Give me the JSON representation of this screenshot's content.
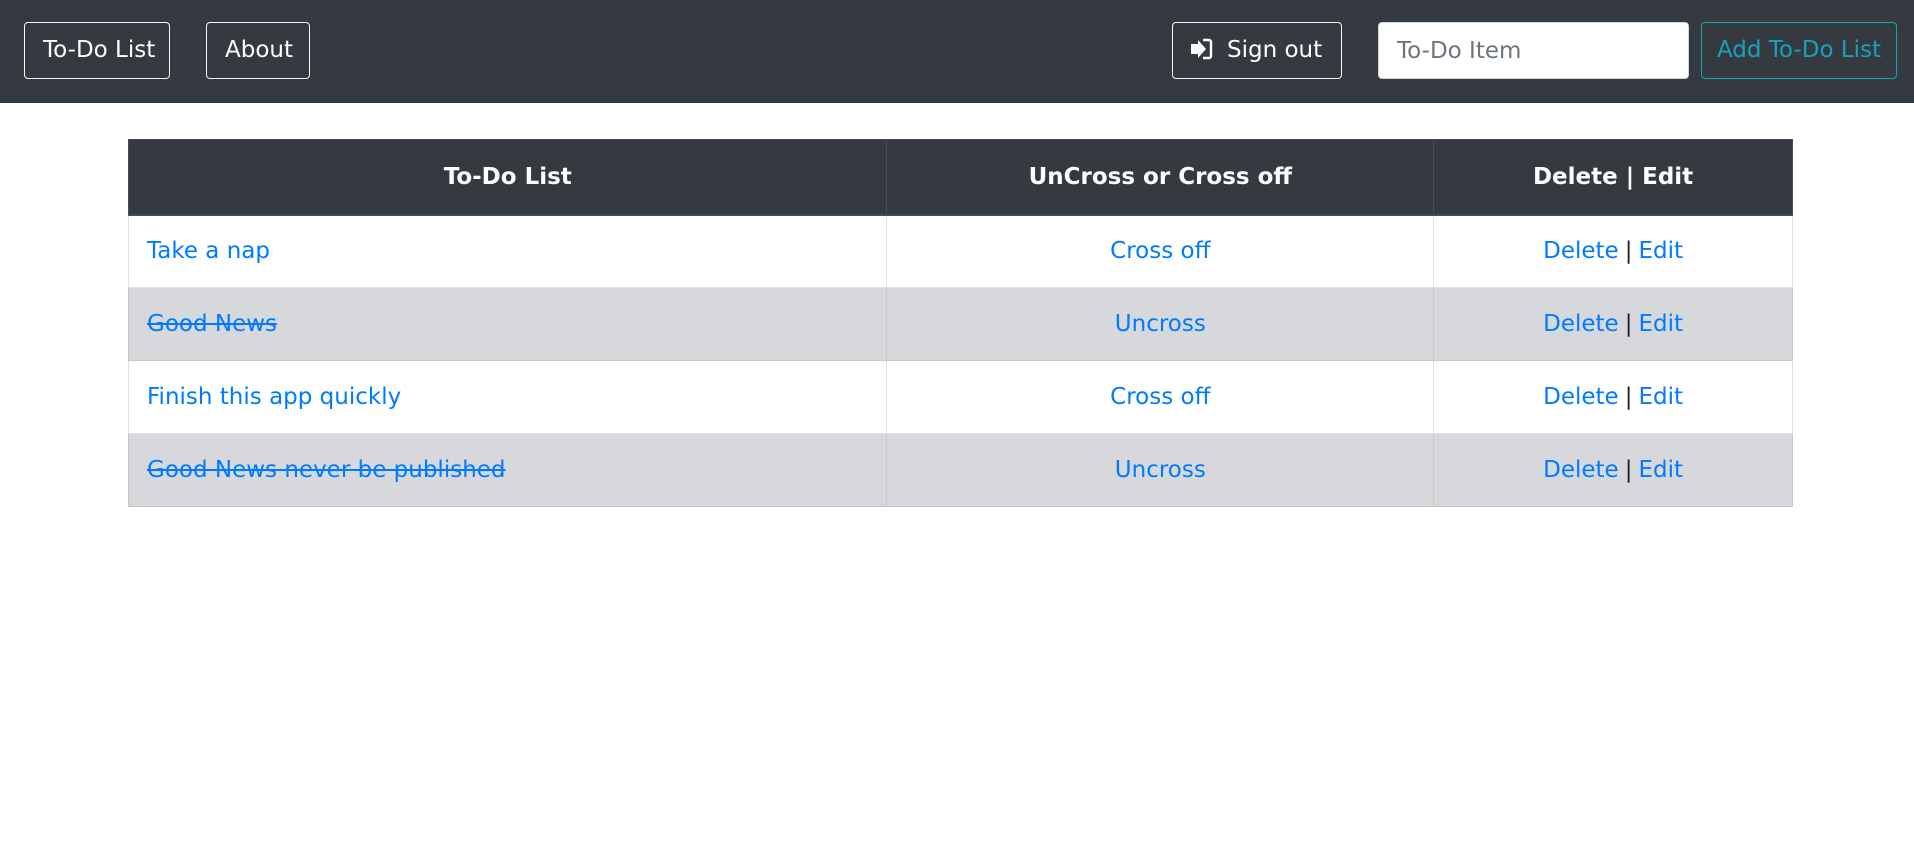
{
  "navbar": {
    "todo_list_label": "To-Do List",
    "about_label": "About",
    "sign_out_label": "Sign out",
    "sign_out_icon": "sign-out-icon",
    "input_placeholder": "To-Do Item",
    "input_value": "",
    "add_label": "Add To-Do List"
  },
  "table": {
    "headers": [
      "To-Do List",
      "UnCross or Cross off",
      "Delete | Edit"
    ],
    "rows": [
      {
        "item": "Take a nap",
        "crossed": false,
        "toggle_label": "Cross off",
        "delete_label": "Delete",
        "separator": "|",
        "edit_label": "Edit"
      },
      {
        "item": "Good News",
        "crossed": true,
        "toggle_label": "Uncross",
        "delete_label": "Delete",
        "separator": "|",
        "edit_label": "Edit"
      },
      {
        "item": "Finish this app quickly",
        "crossed": false,
        "toggle_label": "Cross off",
        "delete_label": "Delete",
        "separator": "|",
        "edit_label": "Edit"
      },
      {
        "item": "Good News never be published",
        "crossed": true,
        "toggle_label": "Uncross",
        "delete_label": "Delete",
        "separator": "|",
        "edit_label": "Edit"
      }
    ]
  },
  "colors": {
    "navbar_bg": "#343a40",
    "link": "#007bff",
    "add_button": "#17a2b8",
    "crossed_row_bg": "#d6d8db"
  }
}
